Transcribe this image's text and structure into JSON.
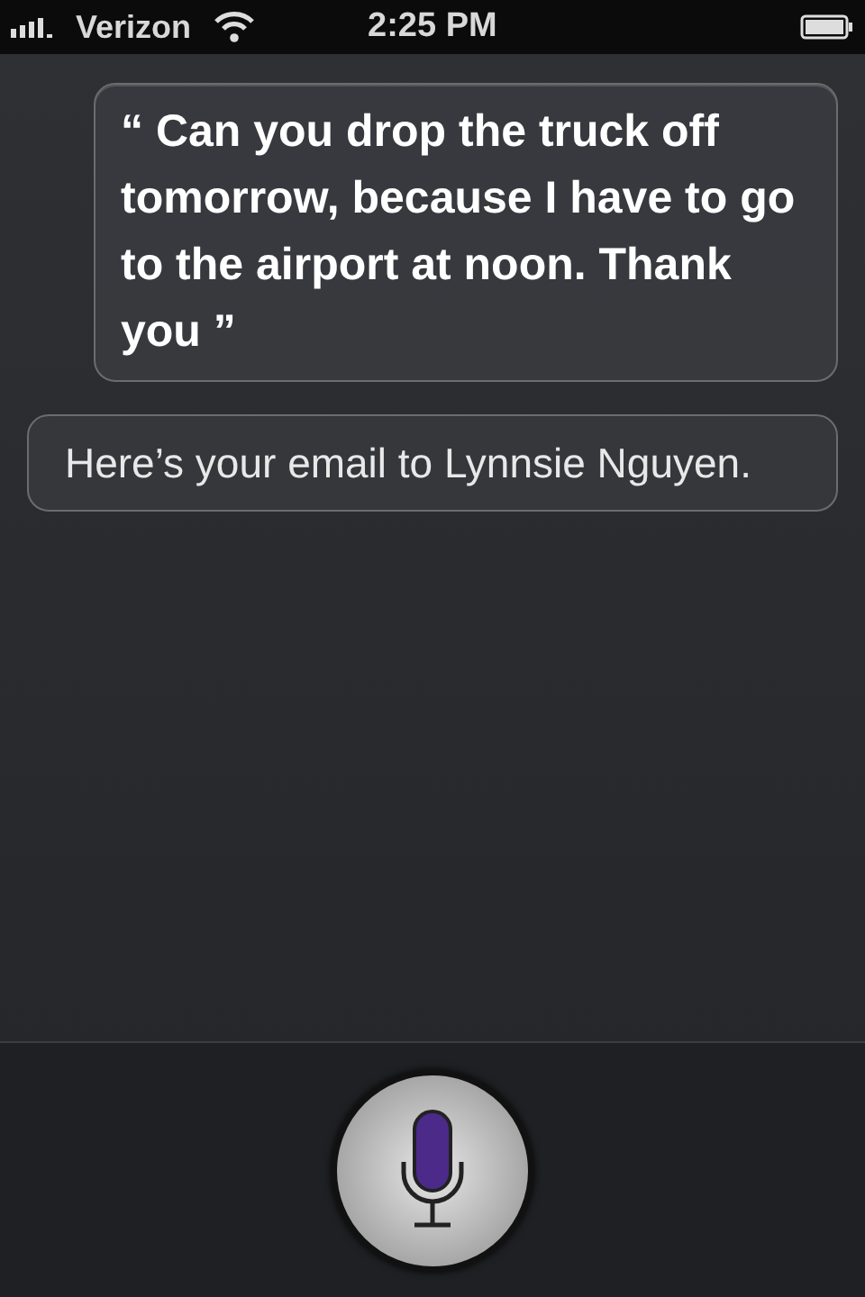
{
  "status_bar": {
    "carrier": "Verizon",
    "time": "2:25 PM"
  },
  "conversation": [
    {
      "kind": "user",
      "text": "“ Can you drop the truck off tomorrow, because I have to go to the airport at noon. Thank you ”"
    },
    {
      "kind": "assistant",
      "text": "Here’s your email to Lynnsie Nguyen."
    }
  ],
  "mic_button": {
    "listening": false
  }
}
